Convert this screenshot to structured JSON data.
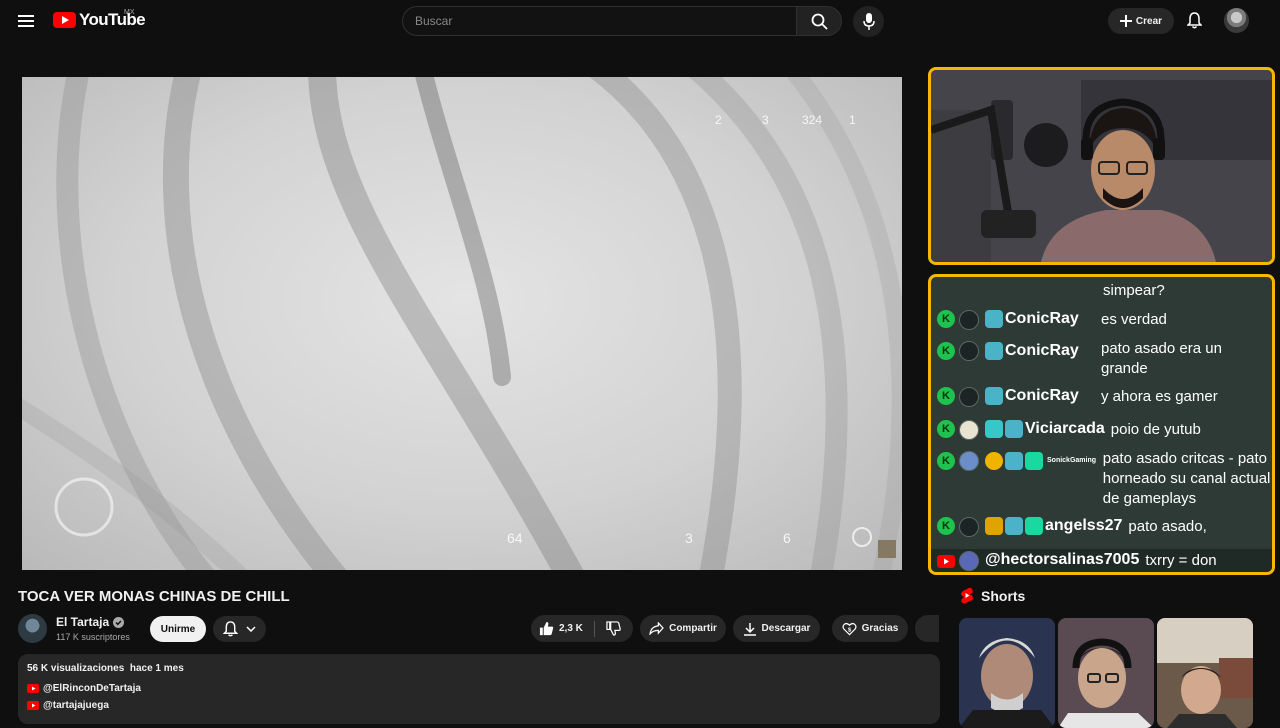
{
  "header": {
    "logo_text": "YouTube",
    "country_code": "MX",
    "search_placeholder": "Buscar",
    "create_label": "Crear"
  },
  "player": {
    "hud_values": [
      "2",
      "3",
      "324",
      "1",
      "64",
      "3",
      "6"
    ]
  },
  "chat": {
    "messages": [
      {
        "user": "",
        "text": "simpear?"
      },
      {
        "user": "ConicRay",
        "text": "es verdad"
      },
      {
        "user": "ConicRay",
        "text": "pato asado era un grande"
      },
      {
        "user": "ConicRay",
        "text": "y ahora es gamer"
      },
      {
        "user": "Viciarcada",
        "text": "poio de yutub"
      },
      {
        "user": "SonickGaming",
        "text": "pato asado critcas - pato horneado su canal actual de gameplays"
      },
      {
        "user": "angelss27",
        "text": "pato asado,"
      },
      {
        "user": "@hectorsalinas7005",
        "text": "txrry = don migajas"
      }
    ]
  },
  "video": {
    "title": "TOCA VER MONAS CHINAS DE CHILL",
    "channel_name": "El Tartaja",
    "subscribers": "117 K suscriptores",
    "join_label": "Unirme",
    "likes": "2,3 K",
    "share_label": "Compartir",
    "download_label": "Descargar",
    "thanks_label": "Gracias"
  },
  "description": {
    "views": "56 K visualizaciones",
    "age": "hace 1 mes",
    "links": [
      "@ElRinconDeTartaja",
      "@tartajajuega"
    ]
  },
  "shorts": {
    "heading": "Shorts"
  },
  "colors": {
    "accent_red": "#ff0000",
    "chat_border": "#f5b800",
    "chat_bg": "#2d3a36",
    "kick_green": "#1ec24c"
  }
}
